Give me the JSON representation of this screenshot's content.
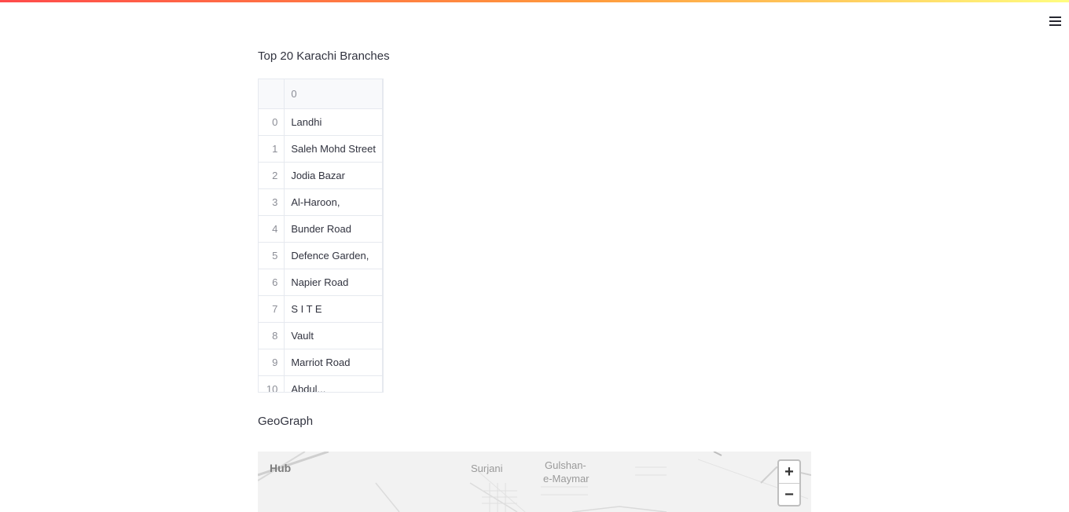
{
  "header": {
    "menu_icon": "hamburger-menu-icon"
  },
  "table_section": {
    "title": "Top 20 Karachi Branches",
    "column_header": "0",
    "rows": [
      {
        "index": "0",
        "value": "Landhi"
      },
      {
        "index": "1",
        "value": "Saleh Mohd Street"
      },
      {
        "index": "2",
        "value": "Jodia Bazar"
      },
      {
        "index": "3",
        "value": "Al-Haroon,"
      },
      {
        "index": "4",
        "value": "Bunder Road"
      },
      {
        "index": "5",
        "value": "Defence Garden,"
      },
      {
        "index": "6",
        "value": "Napier Road"
      },
      {
        "index": "7",
        "value": "S I T E"
      },
      {
        "index": "8",
        "value": "Vault"
      },
      {
        "index": "9",
        "value": "Marriot Road"
      },
      {
        "index": "10",
        "value": "Abdul..."
      }
    ]
  },
  "map_section": {
    "title": "GeoGraph",
    "labels": {
      "hub": "Hub",
      "surjani": "Surjani",
      "gulshan_line1": "Gulshan-",
      "gulshan_line2": "e-Maymar"
    },
    "zoom_in": "+",
    "zoom_out": "−"
  }
}
